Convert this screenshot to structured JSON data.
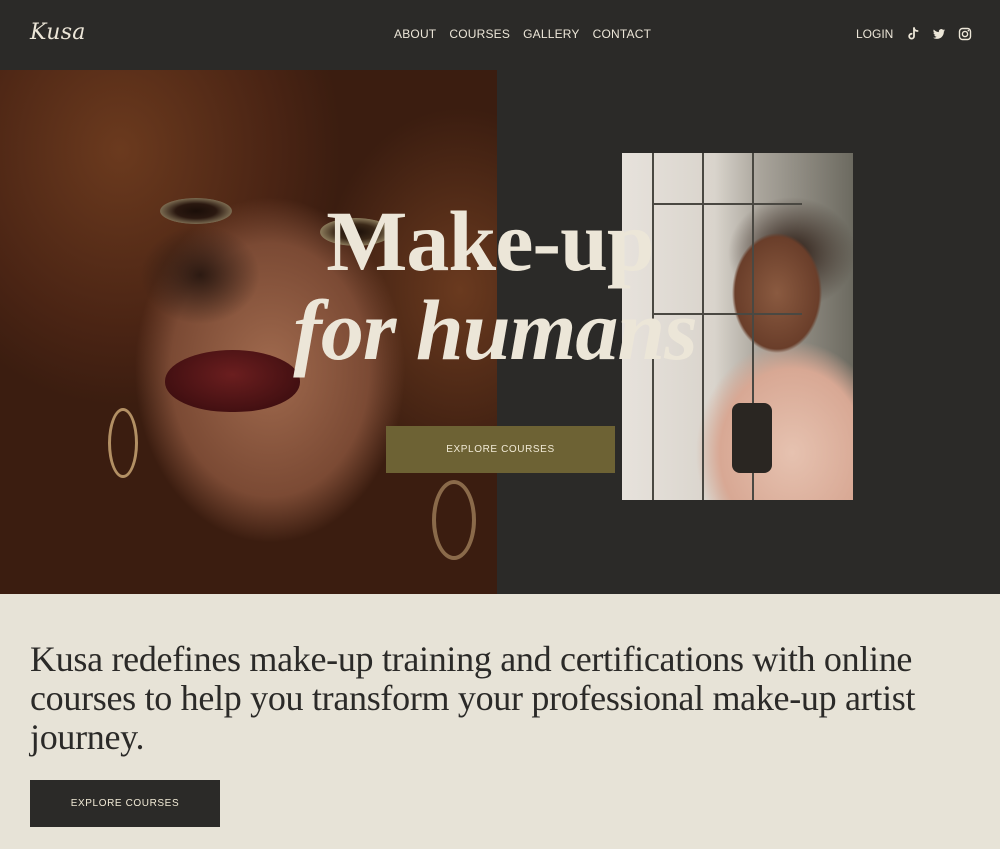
{
  "header": {
    "logo": "Kusa",
    "nav": [
      "ABOUT",
      "COURSES",
      "GALLERY",
      "CONTACT"
    ],
    "login": "LOGIN",
    "socials": [
      "tiktok-icon",
      "twitter-icon",
      "instagram-icon"
    ]
  },
  "hero": {
    "title_line1": "Make-up",
    "title_line2": "for humans",
    "cta_label": "EXPLORE COURSES"
  },
  "intro": {
    "text": "Kusa redefines make-up training and certifications with online courses to help you transform your professional make-up artist journey.",
    "cta_label": "EXPLORE COURSES"
  },
  "colors": {
    "dark": "#2b2a28",
    "cream": "#e7e3d7",
    "olive": "#6d6234",
    "text_light": "#ece6d8"
  }
}
